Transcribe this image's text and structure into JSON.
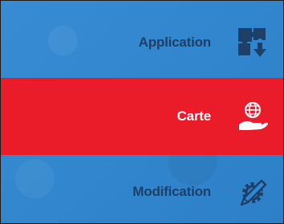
{
  "menu": {
    "items": [
      {
        "label": "Application",
        "icon": "puzzle-download-icon",
        "active": false
      },
      {
        "label": "Carte",
        "icon": "globe-hand-icon",
        "active": true
      },
      {
        "label": "Modification",
        "icon": "gear-pencil-icon",
        "active": false
      }
    ]
  },
  "colors": {
    "background": "#2f87d2",
    "active_background": "#eb1c2a",
    "inactive_text": "#1e3f67",
    "active_text": "#ffffff"
  }
}
